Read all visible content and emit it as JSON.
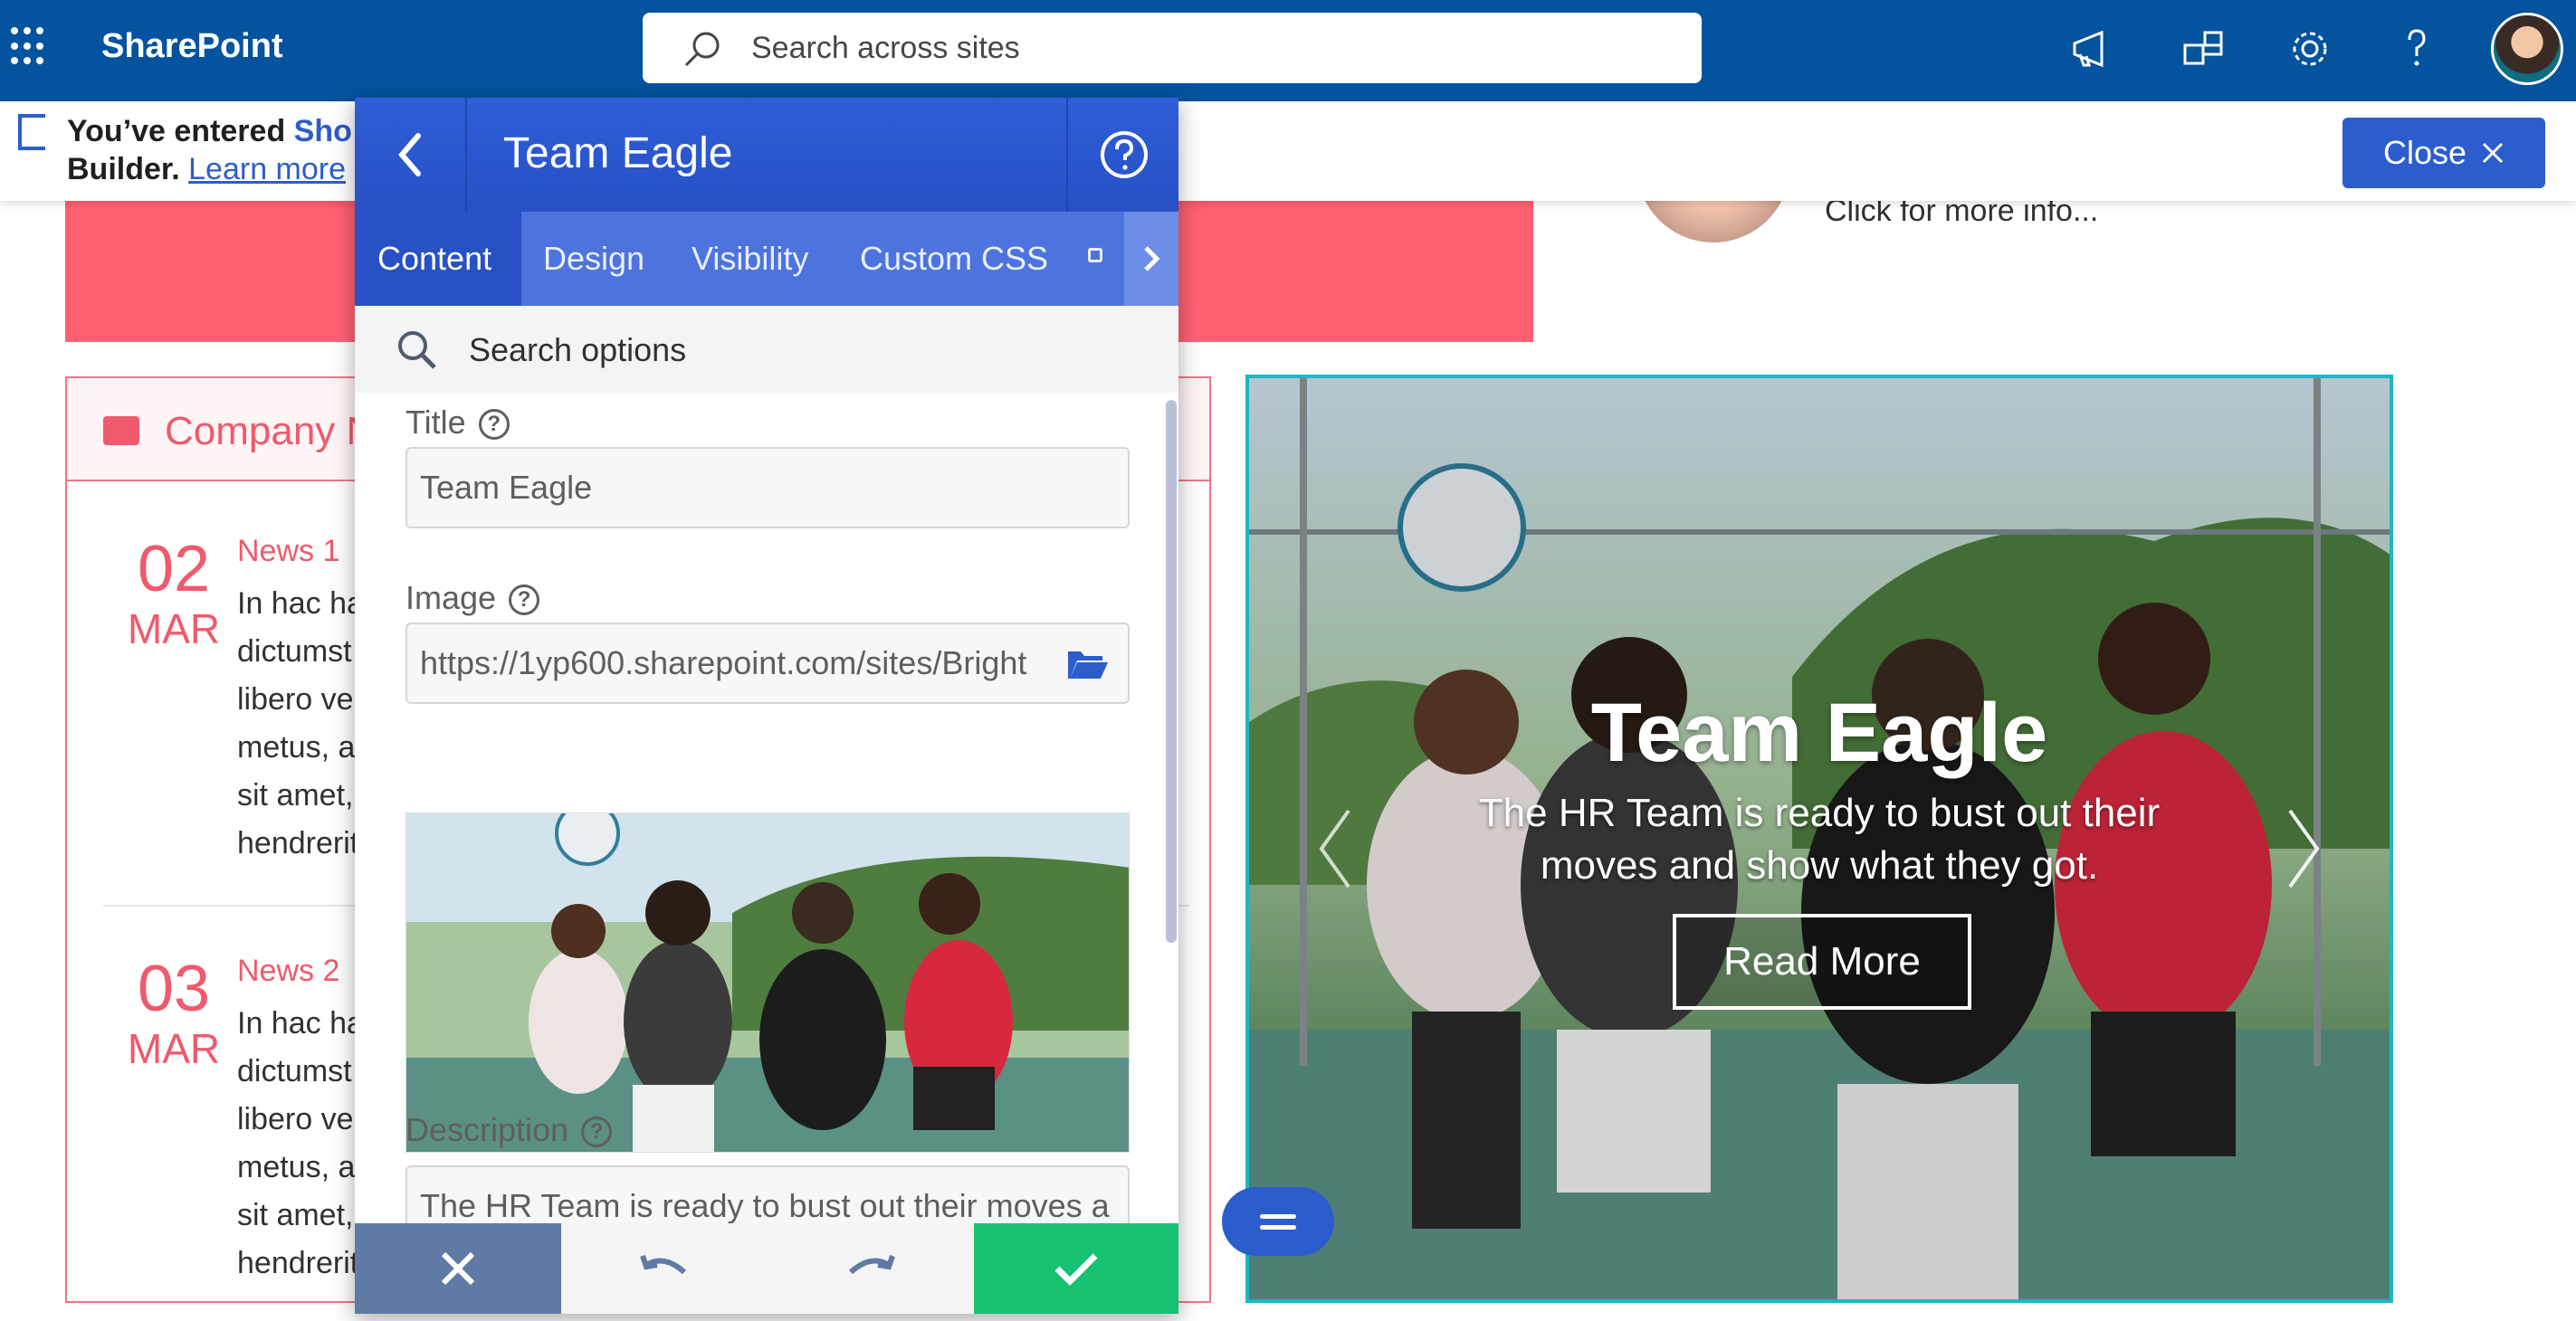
{
  "topbar": {
    "brand": "SharePoint",
    "search_placeholder": "Search across sites",
    "icons": [
      "waffle-icon",
      "megaphone-icon",
      "teams-icon",
      "gear-icon",
      "help-icon",
      "avatar"
    ]
  },
  "notice": {
    "line1_prefix": "You’ve entered ",
    "line1_highlight": "Sho",
    "line2_prefix": "Builder. ",
    "learn_more": "Learn more",
    "close_label": "Close"
  },
  "news": {
    "header": "Company N",
    "items": [
      {
        "day": "02",
        "month": "MAR",
        "title": "News 1",
        "lines": [
          "In hac ha",
          "dictumst",
          "libero ve",
          "metus, a",
          "sit amet,",
          "hendrerit"
        ]
      },
      {
        "day": "03",
        "month": "MAR",
        "title": "News 2",
        "lines": [
          "In hac ha",
          "dictumst",
          "libero ve",
          "metus, a",
          "sit amet,",
          "hendrerit"
        ]
      }
    ]
  },
  "profile": {
    "info": "Click for more info..."
  },
  "hero": {
    "title": "Team Eagle",
    "description_line1": "The HR Team is ready to bust out their",
    "description_line2": "moves and show what they got.",
    "button": "Read More"
  },
  "panel": {
    "title": "Team Eagle",
    "tabs": [
      "Content",
      "Design",
      "Visibility",
      "Custom CSS"
    ],
    "active_tab": "Content",
    "search_placeholder": "Search options",
    "fields": {
      "title_label": "Title",
      "title_value": "Team Eagle",
      "image_label": "Image",
      "image_value": "https://1yp600.sharepoint.com/sites/Bright",
      "description_label": "Description",
      "description_value": "The HR Team is ready to bust out their moves a"
    },
    "help_glyph": "?"
  },
  "colors": {
    "suite_bar": "#03539e",
    "accent": "#2c5dcd",
    "news_pink": "#ef5a6c",
    "banner_pink": "#ff6172",
    "apply_green": "#16c172",
    "hero_border": "#1fb6c5"
  }
}
